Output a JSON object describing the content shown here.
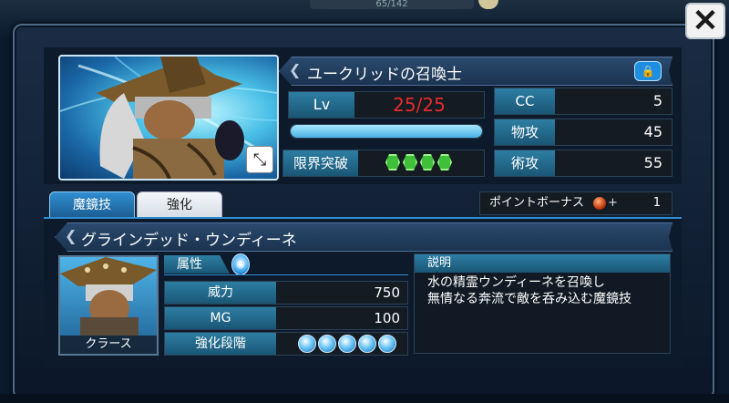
{
  "top": {
    "counter_text": "65/142"
  },
  "close": {
    "label": "✕"
  },
  "unit": {
    "name": "ユークリッドの召喚士",
    "level_label": "Lv",
    "level_value": "25/25",
    "exp_fill_percent": 100,
    "limit_break_label": "限界突破",
    "limit_break_gems": 4,
    "stats": [
      {
        "label": "CC",
        "value": "5"
      },
      {
        "label": "物攻",
        "value": "45"
      },
      {
        "label": "術攻",
        "value": "55"
      }
    ]
  },
  "tabs": [
    {
      "label": "魔鏡技",
      "active": true
    },
    {
      "label": "強化",
      "active": false
    }
  ],
  "points": {
    "label": "ポイントボーナス",
    "plus": "+",
    "value": "1"
  },
  "skill": {
    "name": "グラインデッド・ウンディーネ",
    "character_name": "クラース",
    "attribute_label": "属性",
    "rows": [
      {
        "label": "威力",
        "value": "750"
      },
      {
        "label": "MG",
        "value": "100"
      },
      {
        "label": "強化段階",
        "value": ""
      }
    ],
    "enhance_stage": 5,
    "description_label": "説明",
    "description_lines": [
      "水の精霊ウンディーネを召喚し",
      "無情なる奔流で敵を呑み込む魔鏡技"
    ]
  },
  "colors": {
    "accent_blue": "#2f8ed0",
    "level_red": "#e32b2b",
    "gem_green": "#3fbf3a"
  },
  "icons": [
    "close-icon",
    "lock-icon",
    "resize-icon",
    "water-element-icon",
    "point-orb-icon"
  ]
}
